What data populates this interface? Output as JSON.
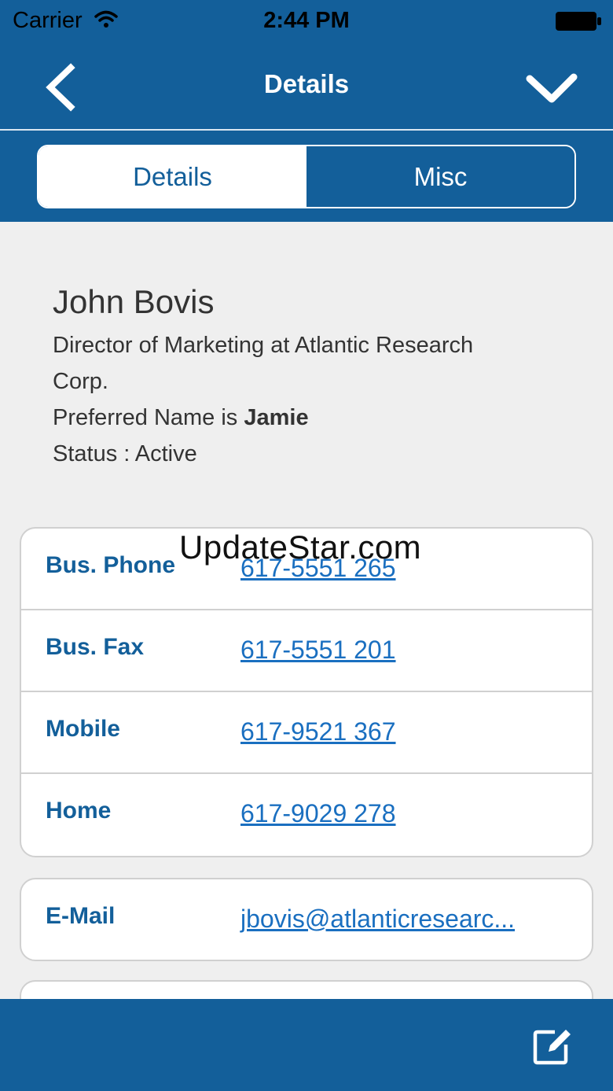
{
  "status_bar": {
    "carrier": "Carrier",
    "time": "2:44 PM",
    "icons": [
      "wifi-icon",
      "battery-icon"
    ]
  },
  "nav": {
    "title": "Details",
    "back_icon": "chevron-left-icon",
    "done_icon": "checkmark-icon"
  },
  "tabs": [
    {
      "label": "Details",
      "selected": true
    },
    {
      "label": "Misc",
      "selected": false
    }
  ],
  "profile": {
    "name": "John Bovis",
    "title_line1": "Director of Marketing at Atlantic Research",
    "title_line2": "Corp.",
    "preferred_prefix": "Preferred Name is ",
    "preferred_name": "Jamie",
    "status": "Status : Active"
  },
  "phones": [
    {
      "label": "Bus. Phone",
      "value": "617-5551 265"
    },
    {
      "label": "Bus. Fax",
      "value": "617-5551 201"
    },
    {
      "label": "Mobile",
      "value": "617-9521 367"
    },
    {
      "label": "Home",
      "value": "617-9029 278"
    }
  ],
  "email": {
    "label": "E-Mail",
    "value": "jbovis@atlanticresearc..."
  },
  "toolbar": {
    "edit_icon": "edit-icon"
  },
  "watermark": "UpdateStar.com",
  "colors": {
    "primary": "#135f9a",
    "background": "#efefef",
    "link": "#1a6fc0",
    "text": "#333333"
  }
}
